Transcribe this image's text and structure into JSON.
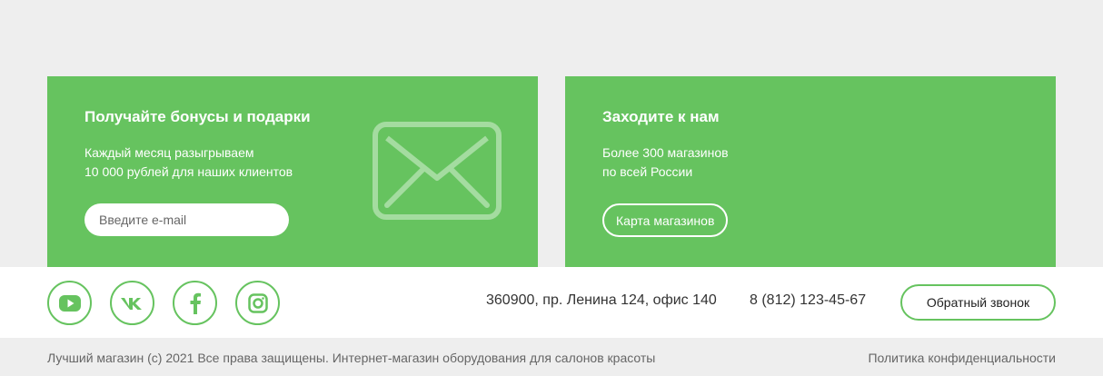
{
  "colors": {
    "accent": "#66c35f",
    "background": "#eeeeee",
    "footer_background": "#ffffff",
    "text_dark": "#333333",
    "text_muted": "#666666"
  },
  "promo_bonus": {
    "title": "Получайте бонусы и подарки",
    "text_line1": "Каждый месяц разыгрываем",
    "text_line2": "10 000 рублей для наших клиентов",
    "email_placeholder": "Введите e-mail",
    "icon": "envelope-icon"
  },
  "promo_stores": {
    "title": "Заходите к нам",
    "text_line1": "Более 300 магазинов",
    "text_line2": "по всей России",
    "button_label": "Карта магазинов"
  },
  "footer": {
    "social": [
      {
        "icon": "youtube-icon"
      },
      {
        "icon": "vk-icon"
      },
      {
        "icon": "facebook-icon"
      },
      {
        "icon": "instagram-icon"
      }
    ],
    "address": "360900, пр. Ленина 124, офис 140",
    "phone": "8 (812) 123-45-67",
    "callback_label": "Обратный звонок",
    "copyright": "Лучший магазин (c) 2021 Все права защищены. Интернет-магазин оборудования для салонов красоты",
    "privacy_label": "Политика конфиденциальности"
  }
}
